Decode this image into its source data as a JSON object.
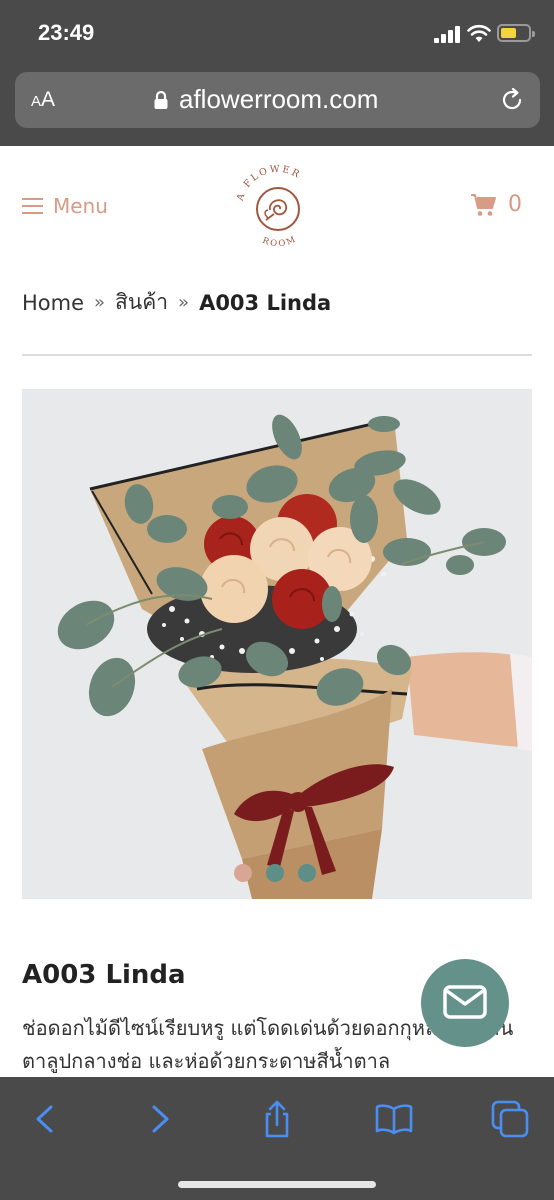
{
  "status_bar": {
    "time": "23:49"
  },
  "browser": {
    "text_size_small": "A",
    "text_size_large": "A",
    "domain": "aflowerroom.com"
  },
  "site_header": {
    "menu_label": "Menu",
    "cart_count": "0",
    "logo_text_top": "A FLOWER",
    "logo_text_bottom": "ROOM"
  },
  "breadcrumb": {
    "home": "Home",
    "separator": "»",
    "category": "สินค้า",
    "current": "A003 Linda"
  },
  "product": {
    "title": "A003 Linda",
    "description": "ช่อดอกไม้ดีไซน์เรียบหรู แต่โดดเด่นด้วยดอกกุหลาบสีแคนตาลูปกลางช่อ และห่อด้วยกระดาษสีน้ำตาล",
    "image_dots": [
      {
        "active": true
      },
      {
        "active": false
      },
      {
        "active": false
      }
    ]
  },
  "colors": {
    "accent": "#d89b85",
    "teal": "#64928b",
    "chrome": "#4a4a4a",
    "ios_blue": "#4b8ef2"
  }
}
